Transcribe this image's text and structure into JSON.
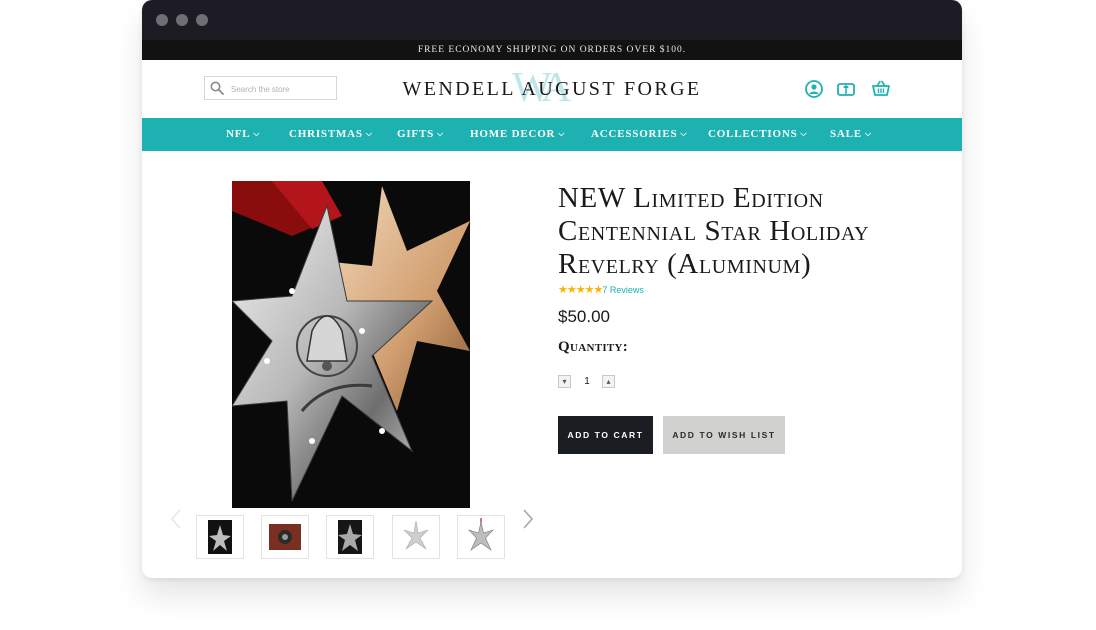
{
  "promo": {
    "text": "FREE ECONOMY SHIPPING ON ORDERS OVER $100."
  },
  "header": {
    "search_placeholder": "Search the store",
    "logo_text": "WENDELL AUGUST FORGE",
    "logo_mark": "WA"
  },
  "nav": {
    "items": [
      {
        "label": "NFL"
      },
      {
        "label": "CHRISTMAS"
      },
      {
        "label": "GIFTS"
      },
      {
        "label": "HOME DECOR"
      },
      {
        "label": "ACCESSORIES"
      },
      {
        "label": "COLLECTIONS"
      },
      {
        "label": "SALE"
      }
    ]
  },
  "product": {
    "title": "NEW Limited Edition Centennial Star Holiday Revelry (Aluminum)",
    "stars": "★★★★★",
    "rating_value": 5,
    "reviews_label": "7 Reviews",
    "price": "$50.00",
    "quantity_label": "Quantity:",
    "quantity_value": "1",
    "add_to_cart": "ADD TO CART",
    "add_to_wish_list": "ADD TO WISH LIST"
  },
  "colors": {
    "accent": "#1eb1b1",
    "dark": "#1a1e22",
    "promo_bg": "#121212",
    "star": "#f7b500"
  },
  "icons": {
    "search": "search-icon",
    "account": "user-icon",
    "gift": "gift-card-icon",
    "cart": "basket-icon",
    "prev": "chevron-left-icon",
    "next": "chevron-right-icon"
  }
}
